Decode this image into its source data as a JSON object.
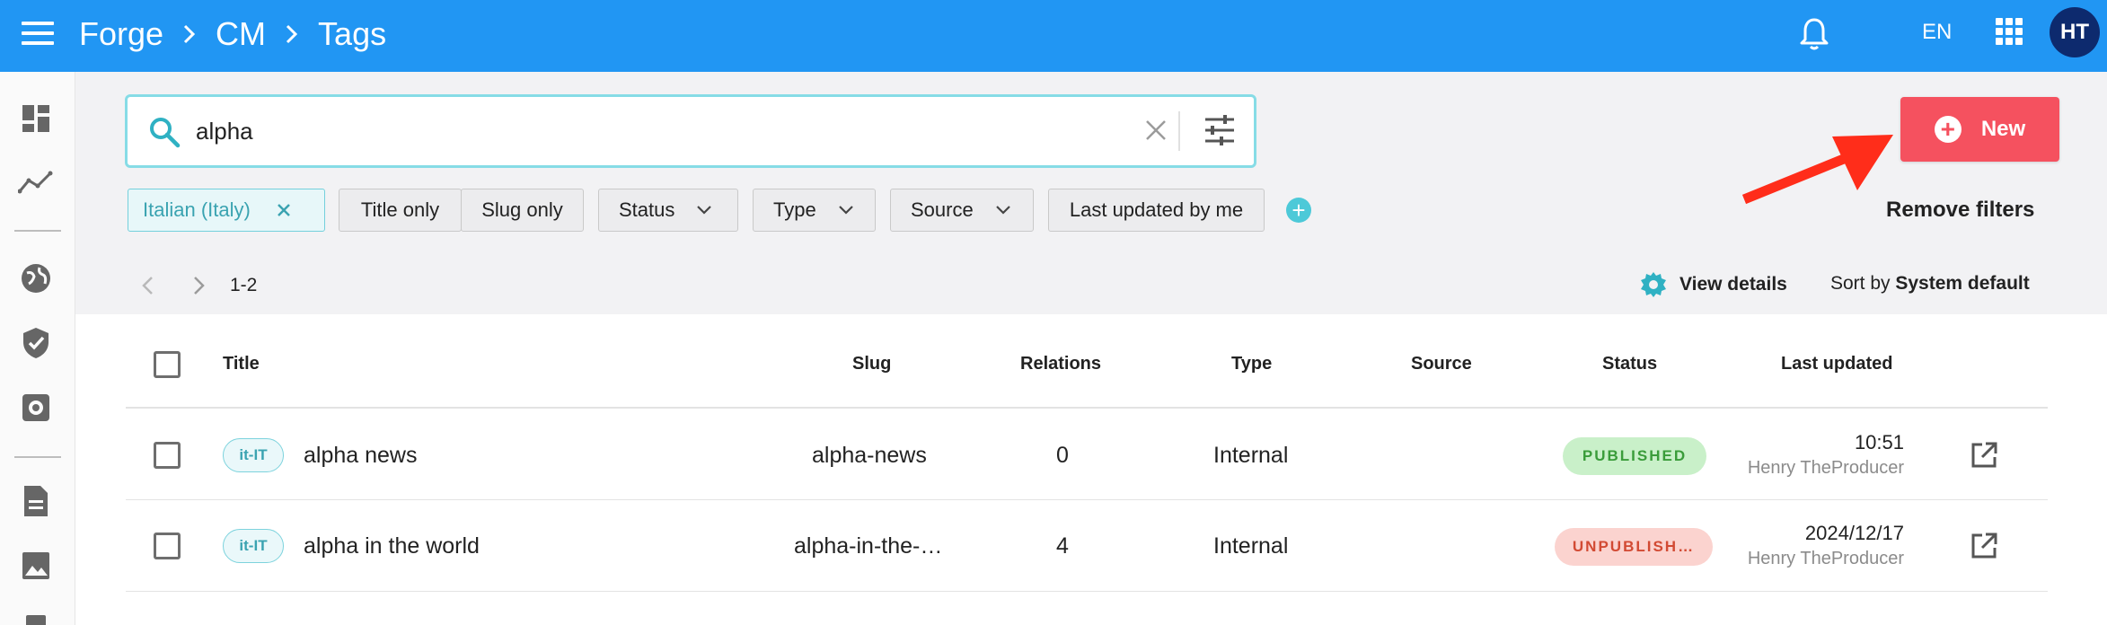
{
  "header": {
    "breadcrumb": [
      "Forge",
      "CM",
      "Tags"
    ],
    "language": "EN",
    "user_initials": "HT"
  },
  "search": {
    "value": "alpha",
    "placeholder": ""
  },
  "new_button": {
    "label": "New"
  },
  "filters": {
    "locale_chip": "Italian (Italy)",
    "title_only": "Title only",
    "slug_only": "Slug only",
    "status": "Status",
    "type": "Type",
    "source": "Source",
    "last_updated_by_me": "Last updated by me",
    "remove_filters": "Remove filters"
  },
  "pagination": {
    "range": "1-2"
  },
  "view_details": "View details",
  "sort": {
    "prefix": "Sort by",
    "value": "System default"
  },
  "table": {
    "columns": {
      "title": "Title",
      "slug": "Slug",
      "relations": "Relations",
      "type": "Type",
      "source": "Source",
      "status": "Status",
      "last_updated": "Last updated"
    },
    "rows": [
      {
        "locale": "it-IT",
        "title": "alpha news",
        "slug": "alpha-news",
        "relations": "0",
        "type": "Internal",
        "source": "",
        "status": "PUBLISHED",
        "updated_time": "10:51",
        "updated_by": "Henry TheProducer"
      },
      {
        "locale": "it-IT",
        "title": "alpha in the world",
        "slug": "alpha-in-the-…",
        "relations": "4",
        "type": "Internal",
        "source": "",
        "status": "UNPUBLISH…",
        "updated_time": "2024/12/17",
        "updated_by": "Henry TheProducer"
      }
    ]
  },
  "colors": {
    "topbar": "#2196f3",
    "accent_teal": "#4dc9d8",
    "new_button": "#f5515f",
    "arrow": "#ff2d1a",
    "published_bg": "#c9f0c9",
    "unpublished_bg": "#fbd3cf"
  },
  "icons": {
    "menu": "menu-icon",
    "notifications": "bell-icon",
    "apps": "apps-grid-icon",
    "search": "search-icon",
    "clear": "close-icon",
    "tune": "tune-icon",
    "settings": "gear-icon",
    "open": "open-in-new-icon"
  }
}
